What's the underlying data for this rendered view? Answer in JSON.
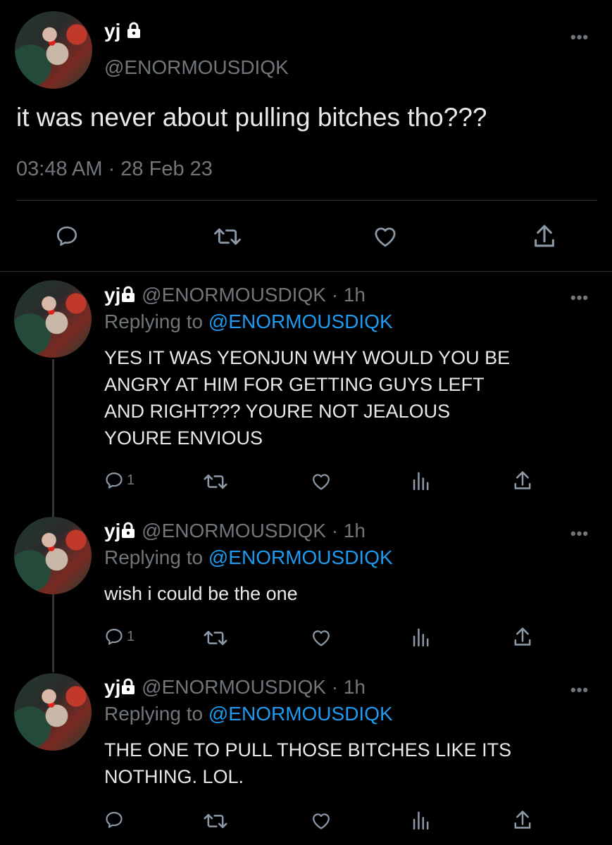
{
  "main_tweet": {
    "author_name": "yj",
    "handle": "@ENORMOUSDIQK",
    "text": "it was never about pulling bitches tho???",
    "timestamp": "03:48 AM · 28 Feb 23"
  },
  "replies": [
    {
      "author_name": "yj",
      "handle": "@ENORMOUSDIQK",
      "time": "· 1h",
      "replying_prefix": "Replying to",
      "replying_to": "@ENORMOUSDIQK",
      "text_lines": [
        "YES IT WAS YEONJUN WHY WOULD YOU BE",
        "ANGRY AT HIM FOR GETTING GUYS LEFT",
        "AND RIGHT??? YOURE NOT JEALOUS",
        "YOURE ENVIOUS"
      ],
      "reply_count": "1"
    },
    {
      "author_name": "yj",
      "handle": "@ENORMOUSDIQK",
      "time": "· 1h",
      "replying_prefix": "Replying to",
      "replying_to": "@ENORMOUSDIQK",
      "text_lines": [
        "wish i could be the one"
      ],
      "reply_count": "1"
    },
    {
      "author_name": "yj",
      "handle": "@ENORMOUSDIQK",
      "time": "· 1h",
      "replying_prefix": "Replying to",
      "replying_to": "@ENORMOUSDIQK",
      "text_lines": [
        "THE ONE TO PULL THOSE BITCHES LIKE ITS",
        "NOTHING. LOL."
      ],
      "reply_count": ""
    }
  ],
  "icons": {
    "more": "more-icon",
    "lock": "lock-icon",
    "reply": "reply-icon",
    "retweet": "retweet-icon",
    "like": "like-icon",
    "views": "views-icon",
    "share": "share-icon"
  },
  "colors": {
    "background": "#000000",
    "text": "#e7e9ea",
    "muted": "#71767b",
    "link": "#1d9bf0",
    "divider": "#2f3336"
  }
}
